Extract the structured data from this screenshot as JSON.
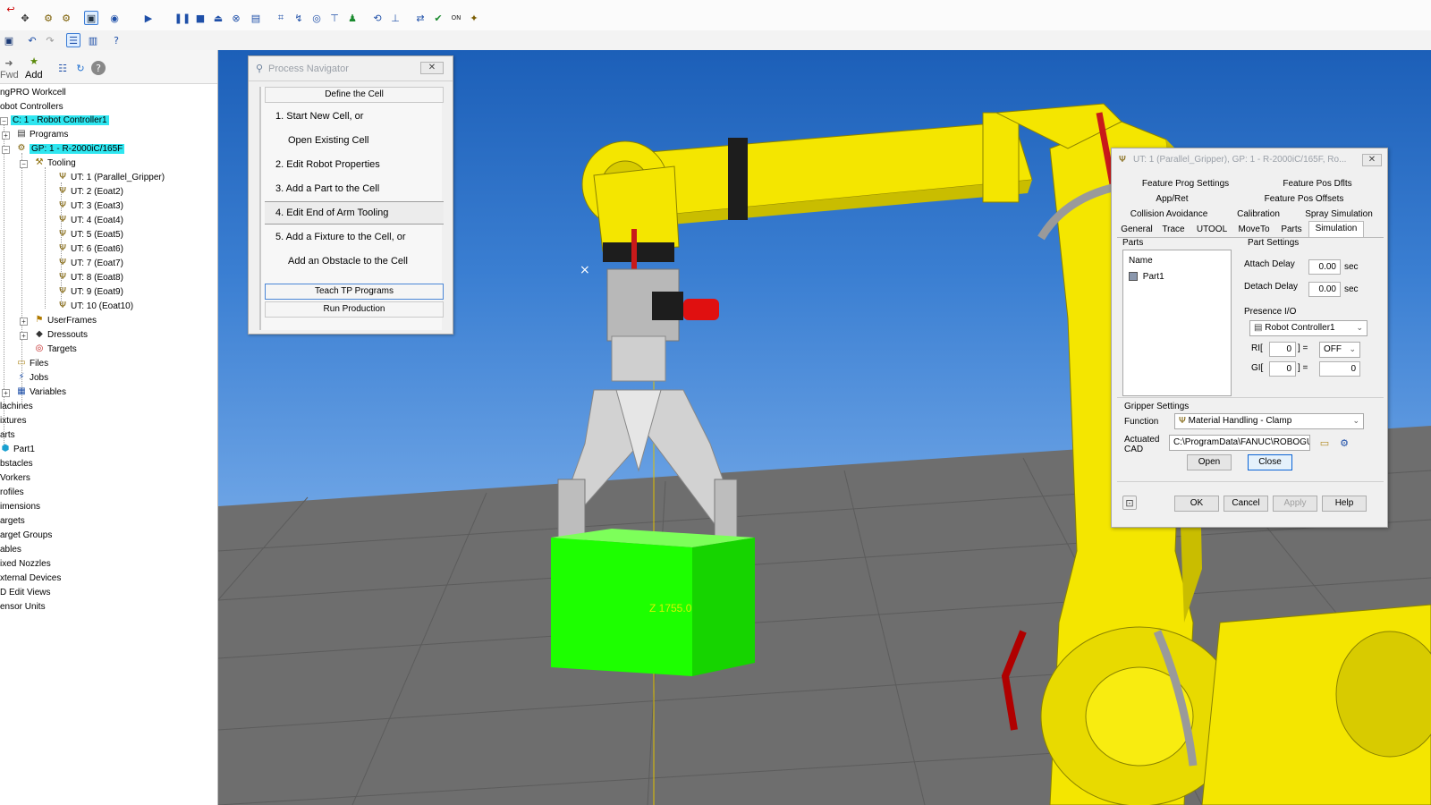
{
  "left_panel": {
    "toolbar": {
      "fwd_label": "Fwd",
      "add_label": "Add"
    },
    "tree": {
      "workcell": "ngPRO Workcell",
      "robot_controllers": "obot Controllers",
      "controller": "C: 1 - Robot Controller1",
      "programs": "Programs",
      "group": "GP: 1 - R-2000iC/165F",
      "tooling": "Tooling",
      "tools": [
        "UT: 1  (Parallel_Gripper)",
        "UT: 2  (Eoat2)",
        "UT: 3  (Eoat3)",
        "UT: 4  (Eoat4)",
        "UT: 5  (Eoat5)",
        "UT: 6  (Eoat6)",
        "UT: 7  (Eoat7)",
        "UT: 8  (Eoat8)",
        "UT: 9  (Eoat9)",
        "UT: 10  (Eoat10)"
      ],
      "userframes": "UserFrames",
      "dressouts": "Dressouts",
      "targets": "Targets",
      "files": "Files",
      "jobs": "Jobs",
      "variables": "Variables",
      "top_level": [
        "lachines",
        "ixtures",
        "arts",
        "Part1",
        "bstacles",
        "Vorkers",
        "rofiles",
        "imensions",
        "argets",
        "arget Groups",
        "ables",
        "ixed Nozzles",
        "xternal Devices",
        "D Edit Views",
        "ensor Units"
      ]
    }
  },
  "process_navigator": {
    "title": "Process Navigator",
    "define_cell": "Define the Cell",
    "steps": [
      "1.   Start New Cell, or",
      "Open Existing Cell",
      "2.   Edit Robot Properties",
      "3.   Add a Part to the Cell",
      "4.   Edit End of Arm Tooling",
      "5.   Add a Fixture to the Cell, or",
      "Add an Obstacle to the Cell"
    ],
    "teach_tp": "Teach TP Programs",
    "run_production": "Run Production"
  },
  "viewport": {
    "z_label": "Z 1755.0",
    "cursor_mark": "×",
    "colors": {
      "robot": "#f4e600",
      "part": "#1dff00",
      "floor": "#6e6e6e",
      "sky": "#3b7fd2"
    }
  },
  "utool_dialog": {
    "title": "UT: 1  (Parallel_Gripper), GP: 1 - R-2000iC/165F, Ro...",
    "tabs_row1": [
      "Feature Prog Settings",
      "Feature Pos Dflts"
    ],
    "tabs_row2": [
      "App/Ret",
      "Feature Pos Offsets"
    ],
    "tabs_row3": [
      "Collision Avoidance",
      "Calibration",
      "Spray Simulation"
    ],
    "tabs_row4": [
      "General",
      "Trace",
      "UTOOL",
      "MoveTo",
      "Parts",
      "Simulation"
    ],
    "parts": {
      "group_label": "Parts",
      "name_header": "Name",
      "items": [
        "Part1"
      ]
    },
    "part_settings": {
      "group_label": "Part Settings",
      "attach_delay_label": "Attach Delay",
      "attach_delay": "0.00",
      "detach_delay_label": "Detach Delay",
      "detach_delay": "0.00",
      "unit": "sec",
      "presence_io_label": "Presence I/O",
      "controller": "Robot Controller1",
      "ri_label": "RI[",
      "ri_index": "0",
      "ri_eq": "] =",
      "ri_value": "OFF",
      "gi_label": "GI[",
      "gi_index": "0",
      "gi_eq": "] =",
      "gi_value": "0"
    },
    "gripper": {
      "group_label": "Gripper Settings",
      "function_label": "Function",
      "function_value": "Material Handling - Clamp",
      "actuated_label": "Actuated",
      "cad_label": "CAD",
      "cad_path": "C:\\ProgramData\\FANUC\\ROBOGUID",
      "open_label": "Open",
      "close_label": "Close"
    },
    "buttons": {
      "ok": "OK",
      "cancel": "Cancel",
      "apply": "Apply",
      "help": "Help"
    }
  }
}
